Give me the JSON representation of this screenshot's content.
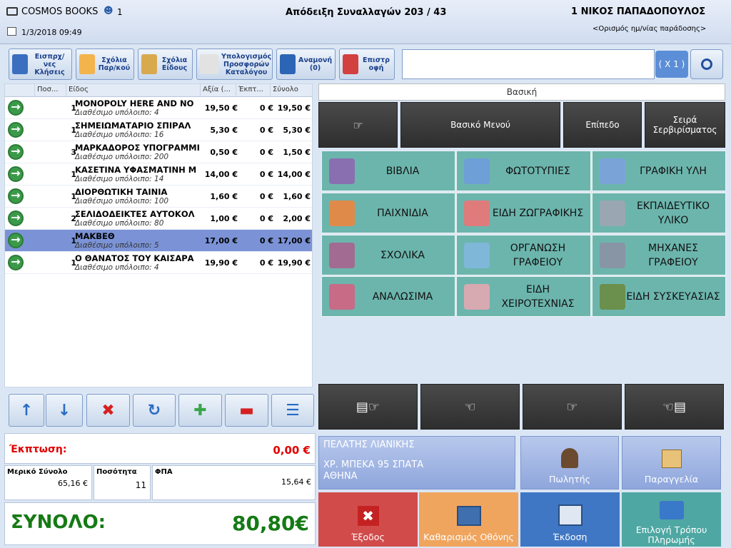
{
  "header": {
    "app_name": "COSMOS BOOKS",
    "user_count": "1",
    "datetime": "1/3/2018 09:49",
    "receipt_title": "Απόδειξη Συναλλαγών  203 / 43",
    "operator": "1 ΝΙΚΟΣ ΠΑΠΑΔΟΠΟΥΛΟΣ",
    "delivery_link": "<Ορισμός ημ/νίας παράδοσης>"
  },
  "toolbar": {
    "collect": "Εισπρχ/νες Κλήσεις",
    "notes_doc": "Σχόλια Παρ/κού",
    "notes_item": "Σχόλια Είδους",
    "offers": "Υπολογισμός Προσφορών Καταλόγου",
    "waiting": "Αναμονή (0)",
    "return": "Επιστρ οφή",
    "multiplier": "( X 1 )",
    "search_placeholder": ""
  },
  "grid": {
    "columns": [
      "Ποσ...",
      "Είδος",
      "Αξία (...",
      "Έκπτ...",
      "Σύνολο"
    ],
    "rows": [
      {
        "qty": "1",
        "name": "MONOPOLY HERE AND NO",
        "sub": "Διαθέσιμο υπόλοιπο: 4",
        "value": "19,50 €",
        "disc": "0 €",
        "total": "19,50 €",
        "selected": false
      },
      {
        "qty": "1",
        "name": "ΣΗΜΕΙΩΜΑΤΑΡΙΟ ΣΠΙΡΑΛ",
        "sub": "Διαθέσιμο υπόλοιπο: 16",
        "value": "5,30 €",
        "disc": "0 €",
        "total": "5,30 €",
        "selected": false
      },
      {
        "qty": "3",
        "name": "ΜΑΡΚΑΔΟΡΟΣ ΥΠΟΓΡΑΜΜΙ",
        "sub": "Διαθέσιμο υπόλοιπο: 200",
        "value": "0,50 €",
        "disc": "0 €",
        "total": "1,50 €",
        "selected": false
      },
      {
        "qty": "1",
        "name": "ΚΑΣΕΤΙΝΑ ΥΦΑΣΜΑΤΙΝΗ Μ",
        "sub": "Διαθέσιμο υπόλοιπο: 14",
        "value": "14,00 €",
        "disc": "0 €",
        "total": "14,00 €",
        "selected": false
      },
      {
        "qty": "1",
        "name": "ΔΙΟΡΘΩΤΙΚΗ ΤΑΙΝΙΑ",
        "sub": "Διαθέσιμο υπόλοιπο: 100",
        "value": "1,60 €",
        "disc": "0 €",
        "total": "1,60 €",
        "selected": false
      },
      {
        "qty": "2",
        "name": "ΣΕΛΙΔΟΔΕΙΚΤΕΣ ΑΥΤΟΚΟΛ",
        "sub": "Διαθέσιμο υπόλοιπο: 80",
        "value": "1,00 €",
        "disc": "0 €",
        "total": "2,00 €",
        "selected": false
      },
      {
        "qty": "1",
        "name": "ΜΑΚΒΕΘ",
        "sub": "Διαθέσιμο υπόλοιπο: 5",
        "value": "17,00 €",
        "disc": "0 €",
        "total": "17,00 €",
        "selected": true
      },
      {
        "qty": "1",
        "name": "Ο ΘΑΝΑΤΟΣ ΤΟΥ ΚΑΙΣΑΡΑ",
        "sub": "Διαθέσιμο υπόλοιπο: 4",
        "value": "19,90 €",
        "disc": "0 €",
        "total": "19,90 €",
        "selected": false
      }
    ]
  },
  "summary": {
    "discount_label": "Έκπτωση:",
    "discount_value": "0,00 €",
    "subtotal_label": "Μερικό Σύνολο",
    "subtotal_value": "65,16 €",
    "qty_label": "Ποσότητα",
    "qty_value": "11",
    "vat_label": "ΦΠΑ",
    "vat_value": "15,64 €",
    "total_label": "ΣΥΝΟΛΟ:",
    "total_value": "80,80€"
  },
  "menu": {
    "title": "Βασική",
    "basic_menu": "Βασικό Μενού",
    "level": "Επίπεδο",
    "serving_order": "Σειρά Σερβιρίσματος"
  },
  "categories": [
    {
      "label": "ΒΙΒΛΙΑ",
      "icon": "books-icon"
    },
    {
      "label": "ΦΩΤΟΤΥΠΙΕΣ",
      "icon": "copier-icon"
    },
    {
      "label": "ΓΡΑΦΙΚΗ ΥΛΗ",
      "icon": "stationery-icon"
    },
    {
      "label": "ΠΑΙΧΝΙΔΙΑ",
      "icon": "ball-icon"
    },
    {
      "label": "ΕΙΔΗ ΖΩΓΡΑΦΙΚΗΣ",
      "icon": "palette-icon"
    },
    {
      "label": "ΕΚΠΑΙΔΕΥΤΙΚΟ ΥΛΙΚΟ",
      "icon": "teacher-icon"
    },
    {
      "label": "ΣΧΟΛΙΚΑ",
      "icon": "backpack-icon"
    },
    {
      "label": "ΟΡΓΑΝΩΣΗ ΓΡΑΦΕΙΟΥ",
      "icon": "box-icon"
    },
    {
      "label": "ΜΗΧΑΝΕΣ ΓΡΑΦΕΙΟΥ",
      "icon": "printer-icon"
    },
    {
      "label": "ΑΝΑΛΩΣΙΜΑ",
      "icon": "paint-bucket-icon"
    },
    {
      "label": "ΕΙΔΗ ΧΕΙΡΟΤΕΧΝΙΑΣ",
      "icon": "vase-icon"
    },
    {
      "label": "ΕΙΔΗ ΣΥΣΚΕΥΑΣΙΑΣ",
      "icon": "wrap-roll-icon"
    }
  ],
  "customer": {
    "name": "ΠΕΛΑΤΗΣ ΛΙΑΝΙΚΗΣ",
    "address": "ΧΡ. ΜΠΕΚΑ 95 ΣΠΑΤΑ",
    "city": "ΑΘΗΝΑ"
  },
  "actions": {
    "seller": "Πωλητής",
    "order": "Παραγγελία",
    "exit": "Έξοδος",
    "clear": "Καθαρισμός Οθόνης",
    "issue": "Έκδοση",
    "payment": "Επιλογή Τρόπου Πληρωμής"
  },
  "colors": {
    "exit": "#d24b4b",
    "clear": "#f0a55e",
    "issue": "#3f77c4",
    "payment": "#4ea7a2",
    "category": "#6cb5ad",
    "discount": "#e00000",
    "total": "#157a15"
  }
}
